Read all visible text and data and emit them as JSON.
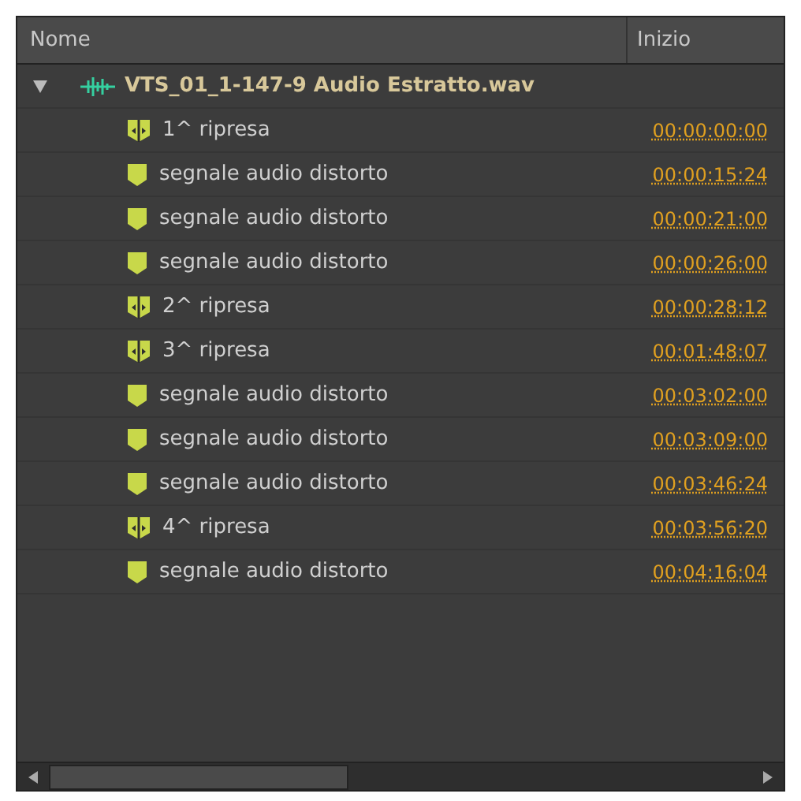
{
  "columns": [
    "Nome",
    "Inizio"
  ],
  "clip": {
    "name": "VTS_01_1-147-9 Audio Estratto.wav",
    "expanded": true,
    "children": [
      {
        "kind": "scene",
        "name": "1^ ripresa",
        "start": "00:00:00:00"
      },
      {
        "kind": "marker",
        "name": "segnale audio distorto",
        "start": "00:00:15:24"
      },
      {
        "kind": "marker",
        "name": "segnale audio distorto",
        "start": "00:00:21:00"
      },
      {
        "kind": "marker",
        "name": "segnale audio distorto",
        "start": "00:00:26:00"
      },
      {
        "kind": "scene",
        "name": "2^ ripresa",
        "start": "00:00:28:12"
      },
      {
        "kind": "scene",
        "name": "3^ ripresa",
        "start": "00:01:48:07"
      },
      {
        "kind": "marker",
        "name": "segnale audio distorto",
        "start": "00:03:02:00"
      },
      {
        "kind": "marker",
        "name": "segnale audio distorto",
        "start": "00:03:09:00"
      },
      {
        "kind": "marker",
        "name": "segnale audio distorto",
        "start": "00:03:46:24"
      },
      {
        "kind": "scene",
        "name": "4^ ripresa",
        "start": "00:03:56:20"
      },
      {
        "kind": "marker",
        "name": "segnale audio distorto",
        "start": "00:04:16:04"
      }
    ]
  }
}
